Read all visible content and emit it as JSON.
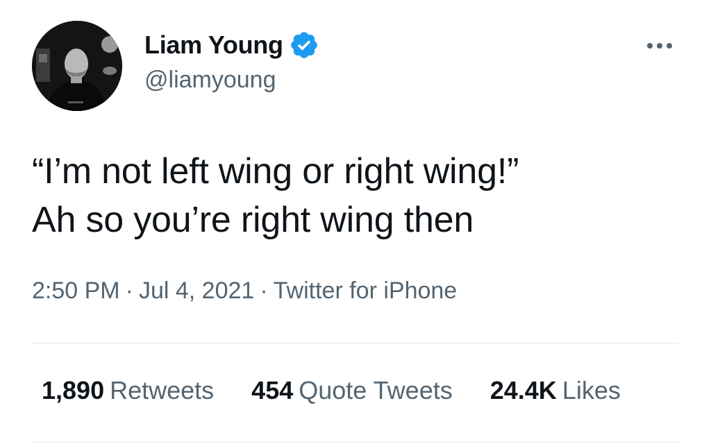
{
  "author": {
    "display_name": "Liam Young",
    "handle": "@liamyoung",
    "verified_icon": "verified-badge-icon",
    "avatar_icon": "profile-photo"
  },
  "tweet": {
    "lines": [
      "“I’m not left wing or right wing!”",
      "Ah so you’re right wing then"
    ]
  },
  "meta": {
    "time": "2:50 PM",
    "separator": "·",
    "date": "Jul 4, 2021",
    "source": "Twitter for iPhone"
  },
  "stats": [
    {
      "count": "1,890",
      "label": "Retweets"
    },
    {
      "count": "454",
      "label": "Quote Tweets"
    },
    {
      "count": "24.4K",
      "label": "Likes"
    }
  ],
  "more_icon": "more-options-icon",
  "colors": {
    "text_primary": "#0f1419",
    "text_secondary": "#536471",
    "verified_blue": "#1d9bf0",
    "divider": "#eff3f4"
  }
}
